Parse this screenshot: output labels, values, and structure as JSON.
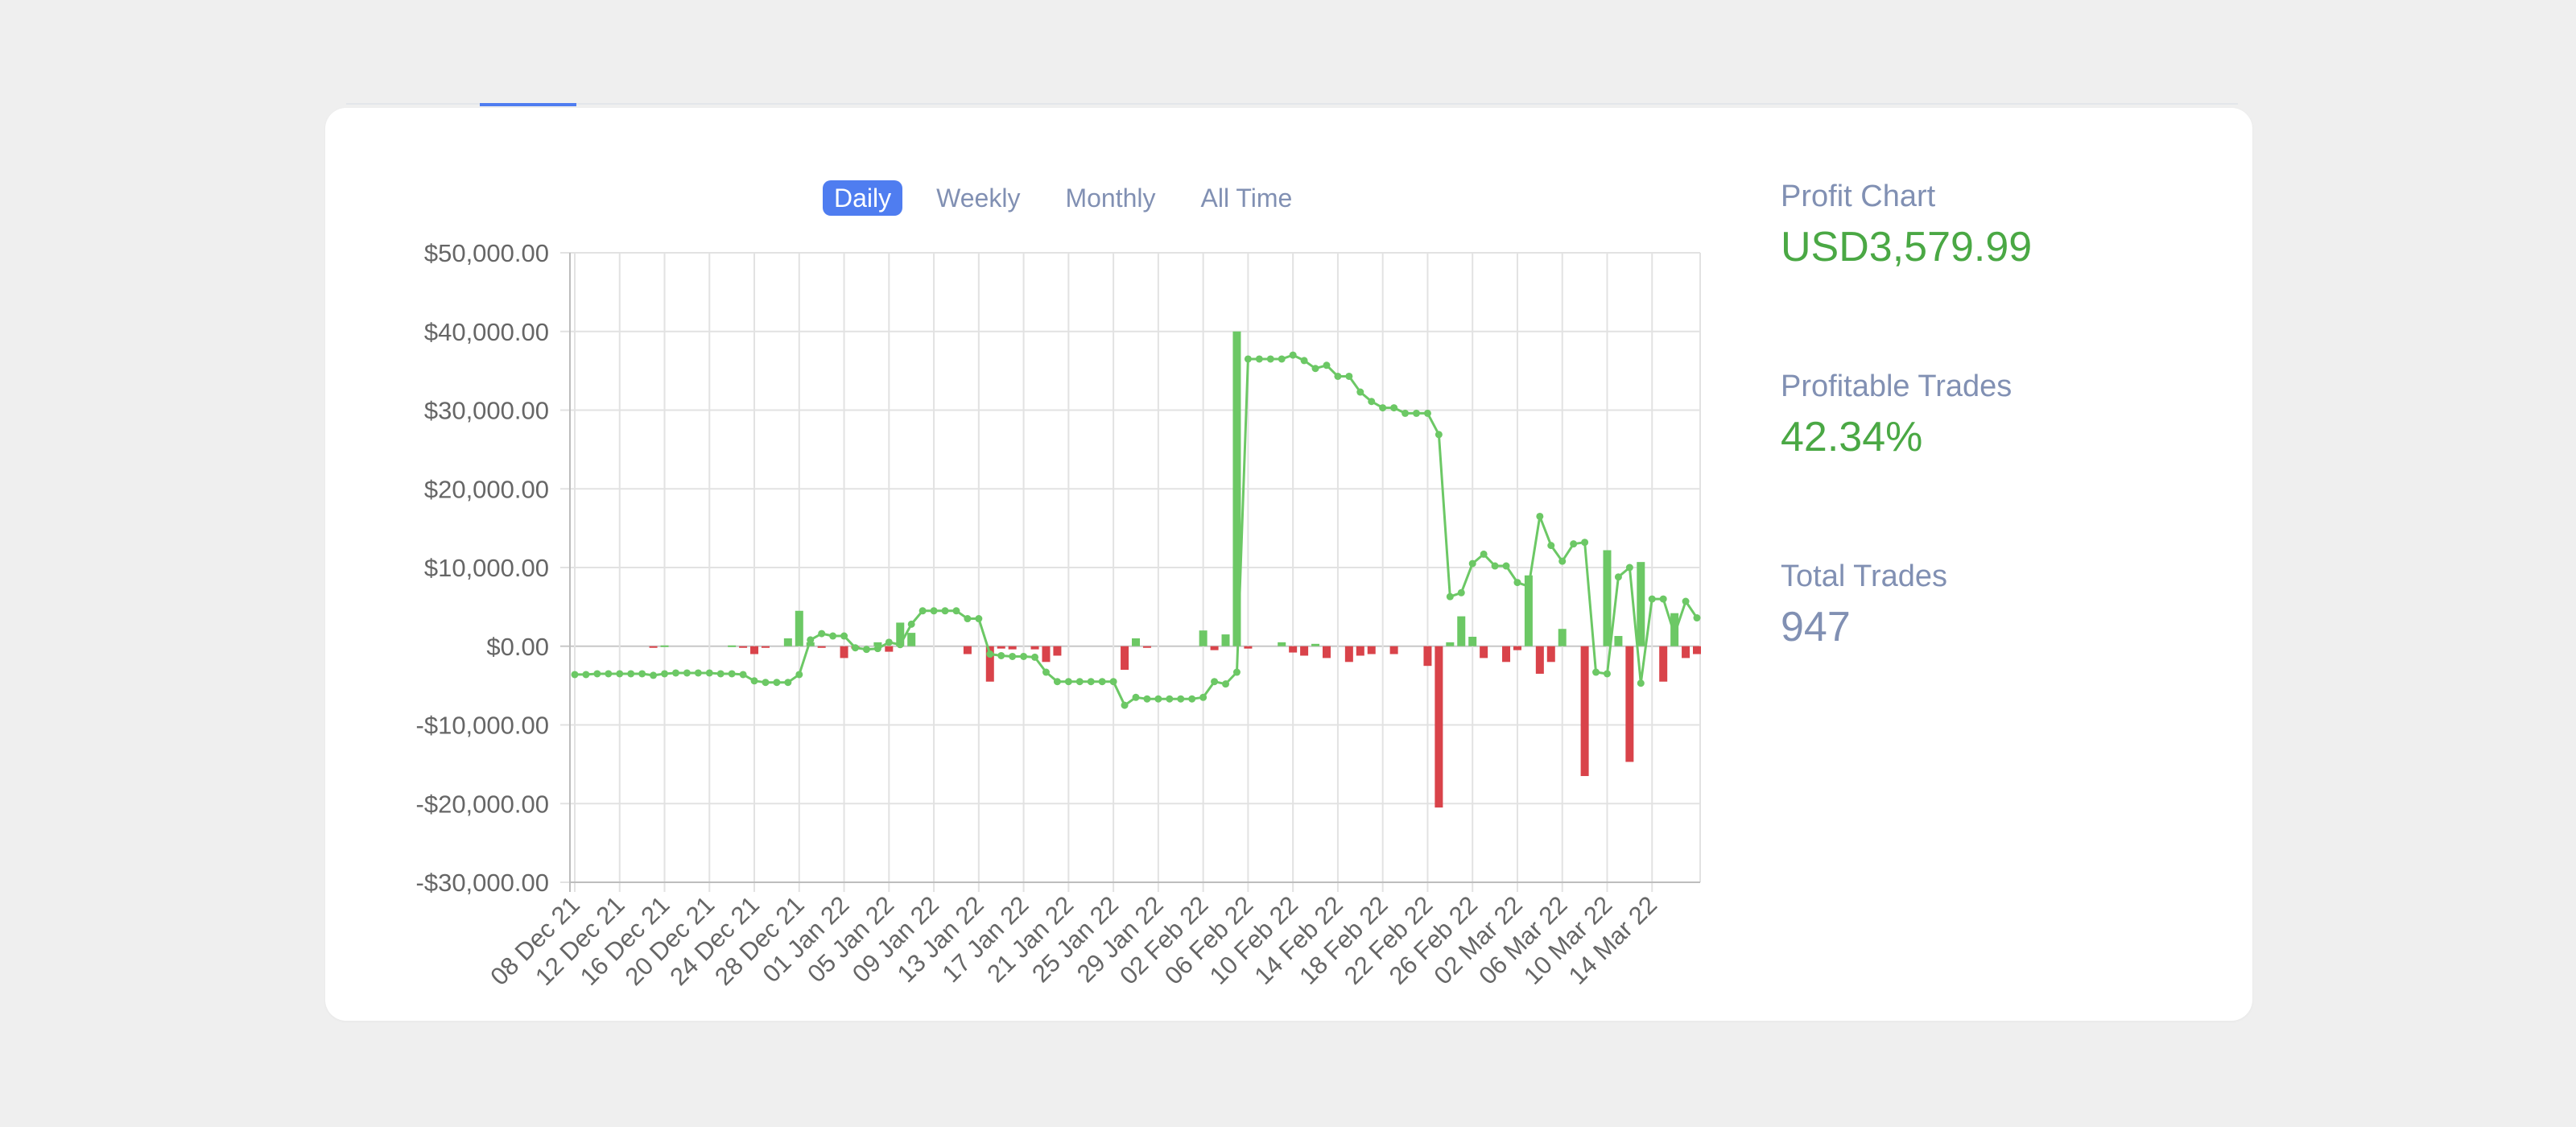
{
  "tabs": [
    {
      "label": "Daily",
      "active": true
    },
    {
      "label": "Weekly",
      "active": false
    },
    {
      "label": "Monthly",
      "active": false
    },
    {
      "label": "All Time",
      "active": false
    }
  ],
  "stats": {
    "profit_chart": {
      "label": "Profit Chart",
      "value": "USD3,579.99"
    },
    "profitable_trades": {
      "label": "Profitable Trades",
      "value": "42.34%"
    },
    "total_trades": {
      "label": "Total Trades",
      "value": "947"
    }
  },
  "colors": {
    "accent": "#4f7df0",
    "positive": "#6cc865",
    "negative": "#d9434a",
    "line": "#6cc865",
    "stat_green": "#4aa844",
    "stat_muted": "#8190b3"
  },
  "chart_data": {
    "type": "bar",
    "title": "",
    "xlabel": "",
    "ylabel": "",
    "ylim": [
      -30000,
      50000
    ],
    "y_ticks": [
      "$50,000.00",
      "$40,000.00",
      "$30,000.00",
      "$20,000.00",
      "$10,000.00",
      "$0.00",
      "-$10,000.00",
      "-$20,000.00",
      "-$30,000.00"
    ],
    "y_tick_values": [
      50000,
      40000,
      30000,
      20000,
      10000,
      0,
      -10000,
      -20000,
      -30000
    ],
    "x_range": [
      "2021-12-08",
      "2022-03-18"
    ],
    "x_ticks": [
      "08 Dec 21",
      "12 Dec 21",
      "16 Dec 21",
      "20 Dec 21",
      "24 Dec 21",
      "28 Dec 21",
      "01 Jan 22",
      "05 Jan 22",
      "09 Jan 22",
      "13 Jan 22",
      "17 Jan 22",
      "21 Jan 22",
      "25 Jan 22",
      "29 Jan 22",
      "02 Feb 22",
      "06 Feb 22",
      "10 Feb 22",
      "14 Feb 22",
      "18 Feb 22",
      "22 Feb 22",
      "26 Feb 22",
      "02 Mar 22",
      "06 Mar 22",
      "10 Mar 22",
      "14 Mar 22"
    ],
    "grid": true,
    "legend": "none",
    "series": [
      {
        "type": "bar",
        "points": [
          {
            "x": "2021-12-15",
            "y": -200
          },
          {
            "x": "2021-12-16",
            "y": 100
          },
          {
            "x": "2021-12-22",
            "y": 100
          },
          {
            "x": "2021-12-23",
            "y": -100
          },
          {
            "x": "2021-12-24",
            "y": -1000
          },
          {
            "x": "2021-12-25",
            "y": -200
          },
          {
            "x": "2021-12-27",
            "y": 1000
          },
          {
            "x": "2021-12-28",
            "y": 4500
          },
          {
            "x": "2021-12-29",
            "y": 500
          },
          {
            "x": "2021-12-30",
            "y": -200
          },
          {
            "x": "2022-01-01",
            "y": -1500
          },
          {
            "x": "2022-01-02",
            "y": -300
          },
          {
            "x": "2022-01-04",
            "y": 500
          },
          {
            "x": "2022-01-05",
            "y": -700
          },
          {
            "x": "2022-01-06",
            "y": 3000
          },
          {
            "x": "2022-01-07",
            "y": 1700
          },
          {
            "x": "2022-01-12",
            "y": -1000
          },
          {
            "x": "2022-01-14",
            "y": -4500
          },
          {
            "x": "2022-01-15",
            "y": -300
          },
          {
            "x": "2022-01-16",
            "y": -400
          },
          {
            "x": "2022-01-18",
            "y": -400
          },
          {
            "x": "2022-01-19",
            "y": -2000
          },
          {
            "x": "2022-01-20",
            "y": -1200
          },
          {
            "x": "2022-01-26",
            "y": -3000
          },
          {
            "x": "2022-01-27",
            "y": 1000
          },
          {
            "x": "2022-01-28",
            "y": -200
          },
          {
            "x": "2022-02-02",
            "y": 2000
          },
          {
            "x": "2022-02-03",
            "y": -500
          },
          {
            "x": "2022-02-04",
            "y": 1500
          },
          {
            "x": "2022-02-05",
            "y": 40000
          },
          {
            "x": "2022-02-06",
            "y": -300
          },
          {
            "x": "2022-02-09",
            "y": 500
          },
          {
            "x": "2022-02-10",
            "y": -800
          },
          {
            "x": "2022-02-11",
            "y": -1200
          },
          {
            "x": "2022-02-12",
            "y": 300
          },
          {
            "x": "2022-02-13",
            "y": -1500
          },
          {
            "x": "2022-02-15",
            "y": -2000
          },
          {
            "x": "2022-02-16",
            "y": -1200
          },
          {
            "x": "2022-02-17",
            "y": -1000
          },
          {
            "x": "2022-02-19",
            "y": -1000
          },
          {
            "x": "2022-02-22",
            "y": -2500
          },
          {
            "x": "2022-02-23",
            "y": -20500
          },
          {
            "x": "2022-02-24",
            "y": 500
          },
          {
            "x": "2022-02-25",
            "y": 3800
          },
          {
            "x": "2022-02-26",
            "y": 1200
          },
          {
            "x": "2022-02-27",
            "y": -1500
          },
          {
            "x": "2022-03-01",
            "y": -2000
          },
          {
            "x": "2022-03-02",
            "y": -500
          },
          {
            "x": "2022-03-03",
            "y": 9000
          },
          {
            "x": "2022-03-04",
            "y": -3500
          },
          {
            "x": "2022-03-05",
            "y": -2000
          },
          {
            "x": "2022-03-06",
            "y": 2200
          },
          {
            "x": "2022-03-08",
            "y": -16500
          },
          {
            "x": "2022-03-10",
            "y": 12200
          },
          {
            "x": "2022-03-11",
            "y": 1300
          },
          {
            "x": "2022-03-12",
            "y": -14700
          },
          {
            "x": "2022-03-13",
            "y": 10700
          },
          {
            "x": "2022-03-15",
            "y": -4500
          },
          {
            "x": "2022-03-16",
            "y": 4200
          },
          {
            "x": "2022-03-17",
            "y": -1500
          },
          {
            "x": "2022-03-18",
            "y": -1000
          }
        ]
      },
      {
        "type": "line",
        "points": [
          {
            "x": "2021-12-08",
            "y": -3600
          },
          {
            "x": "2021-12-09",
            "y": -3600
          },
          {
            "x": "2021-12-10",
            "y": -3500
          },
          {
            "x": "2021-12-11",
            "y": -3500
          },
          {
            "x": "2021-12-12",
            "y": -3500
          },
          {
            "x": "2021-12-13",
            "y": -3500
          },
          {
            "x": "2021-12-14",
            "y": -3500
          },
          {
            "x": "2021-12-15",
            "y": -3700
          },
          {
            "x": "2021-12-16",
            "y": -3500
          },
          {
            "x": "2021-12-17",
            "y": -3400
          },
          {
            "x": "2021-12-18",
            "y": -3400
          },
          {
            "x": "2021-12-19",
            "y": -3400
          },
          {
            "x": "2021-12-20",
            "y": -3400
          },
          {
            "x": "2021-12-21",
            "y": -3500
          },
          {
            "x": "2021-12-22",
            "y": -3500
          },
          {
            "x": "2021-12-23",
            "y": -3600
          },
          {
            "x": "2021-12-24",
            "y": -4400
          },
          {
            "x": "2021-12-25",
            "y": -4600
          },
          {
            "x": "2021-12-26",
            "y": -4600
          },
          {
            "x": "2021-12-27",
            "y": -4600
          },
          {
            "x": "2021-12-28",
            "y": -3600
          },
          {
            "x": "2021-12-29",
            "y": 800
          },
          {
            "x": "2021-12-30",
            "y": 1600
          },
          {
            "x": "2021-12-31",
            "y": 1300
          },
          {
            "x": "2022-01-01",
            "y": 1300
          },
          {
            "x": "2022-01-02",
            "y": -200
          },
          {
            "x": "2022-01-03",
            "y": -400
          },
          {
            "x": "2022-01-04",
            "y": -300
          },
          {
            "x": "2022-01-05",
            "y": 500
          },
          {
            "x": "2022-01-06",
            "y": 200
          },
          {
            "x": "2022-01-07",
            "y": 2800
          },
          {
            "x": "2022-01-08",
            "y": 4500
          },
          {
            "x": "2022-01-09",
            "y": 4500
          },
          {
            "x": "2022-01-10",
            "y": 4500
          },
          {
            "x": "2022-01-11",
            "y": 4500
          },
          {
            "x": "2022-01-12",
            "y": 3500
          },
          {
            "x": "2022-01-13",
            "y": 3500
          },
          {
            "x": "2022-01-14",
            "y": -1000
          },
          {
            "x": "2022-01-15",
            "y": -1200
          },
          {
            "x": "2022-01-16",
            "y": -1300
          },
          {
            "x": "2022-01-17",
            "y": -1300
          },
          {
            "x": "2022-01-18",
            "y": -1400
          },
          {
            "x": "2022-01-19",
            "y": -3300
          },
          {
            "x": "2022-01-20",
            "y": -4500
          },
          {
            "x": "2022-01-21",
            "y": -4500
          },
          {
            "x": "2022-01-22",
            "y": -4500
          },
          {
            "x": "2022-01-23",
            "y": -4500
          },
          {
            "x": "2022-01-24",
            "y": -4500
          },
          {
            "x": "2022-01-25",
            "y": -4500
          },
          {
            "x": "2022-01-26",
            "y": -7500
          },
          {
            "x": "2022-01-27",
            "y": -6500
          },
          {
            "x": "2022-01-28",
            "y": -6700
          },
          {
            "x": "2022-01-29",
            "y": -6700
          },
          {
            "x": "2022-01-30",
            "y": -6700
          },
          {
            "x": "2022-01-31",
            "y": -6700
          },
          {
            "x": "2022-02-01",
            "y": -6700
          },
          {
            "x": "2022-02-02",
            "y": -6500
          },
          {
            "x": "2022-02-03",
            "y": -4500
          },
          {
            "x": "2022-02-04",
            "y": -4800
          },
          {
            "x": "2022-02-05",
            "y": -3300
          },
          {
            "x": "2022-02-06",
            "y": 36500
          },
          {
            "x": "2022-02-07",
            "y": 36500
          },
          {
            "x": "2022-02-08",
            "y": 36500
          },
          {
            "x": "2022-02-09",
            "y": 36500
          },
          {
            "x": "2022-02-10",
            "y": 37000
          },
          {
            "x": "2022-02-11",
            "y": 36300
          },
          {
            "x": "2022-02-12",
            "y": 35300
          },
          {
            "x": "2022-02-13",
            "y": 35700
          },
          {
            "x": "2022-02-14",
            "y": 34300
          },
          {
            "x": "2022-02-15",
            "y": 34300
          },
          {
            "x": "2022-02-16",
            "y": 32300
          },
          {
            "x": "2022-02-17",
            "y": 31100
          },
          {
            "x": "2022-02-18",
            "y": 30300
          },
          {
            "x": "2022-02-19",
            "y": 30300
          },
          {
            "x": "2022-02-20",
            "y": 29600
          },
          {
            "x": "2022-02-21",
            "y": 29600
          },
          {
            "x": "2022-02-22",
            "y": 29600
          },
          {
            "x": "2022-02-23",
            "y": 26900
          },
          {
            "x": "2022-02-24",
            "y": 6300
          },
          {
            "x": "2022-02-25",
            "y": 6800
          },
          {
            "x": "2022-02-26",
            "y": 10500
          },
          {
            "x": "2022-02-27",
            "y": 11700
          },
          {
            "x": "2022-02-28",
            "y": 10200
          },
          {
            "x": "2022-03-01",
            "y": 10200
          },
          {
            "x": "2022-03-02",
            "y": 8100
          },
          {
            "x": "2022-03-03",
            "y": 7600
          },
          {
            "x": "2022-03-04",
            "y": 16500
          },
          {
            "x": "2022-03-05",
            "y": 12800
          },
          {
            "x": "2022-03-06",
            "y": 10800
          },
          {
            "x": "2022-03-07",
            "y": 13000
          },
          {
            "x": "2022-03-08",
            "y": 13200
          },
          {
            "x": "2022-03-09",
            "y": -3300
          },
          {
            "x": "2022-03-10",
            "y": -3500
          },
          {
            "x": "2022-03-11",
            "y": 8800
          },
          {
            "x": "2022-03-12",
            "y": 10000
          },
          {
            "x": "2022-03-13",
            "y": -4700
          },
          {
            "x": "2022-03-14",
            "y": 6000
          },
          {
            "x": "2022-03-15",
            "y": 6000
          },
          {
            "x": "2022-03-16",
            "y": 1500
          },
          {
            "x": "2022-03-17",
            "y": 5700
          },
          {
            "x": "2022-03-18",
            "y": 3600
          }
        ]
      }
    ]
  }
}
